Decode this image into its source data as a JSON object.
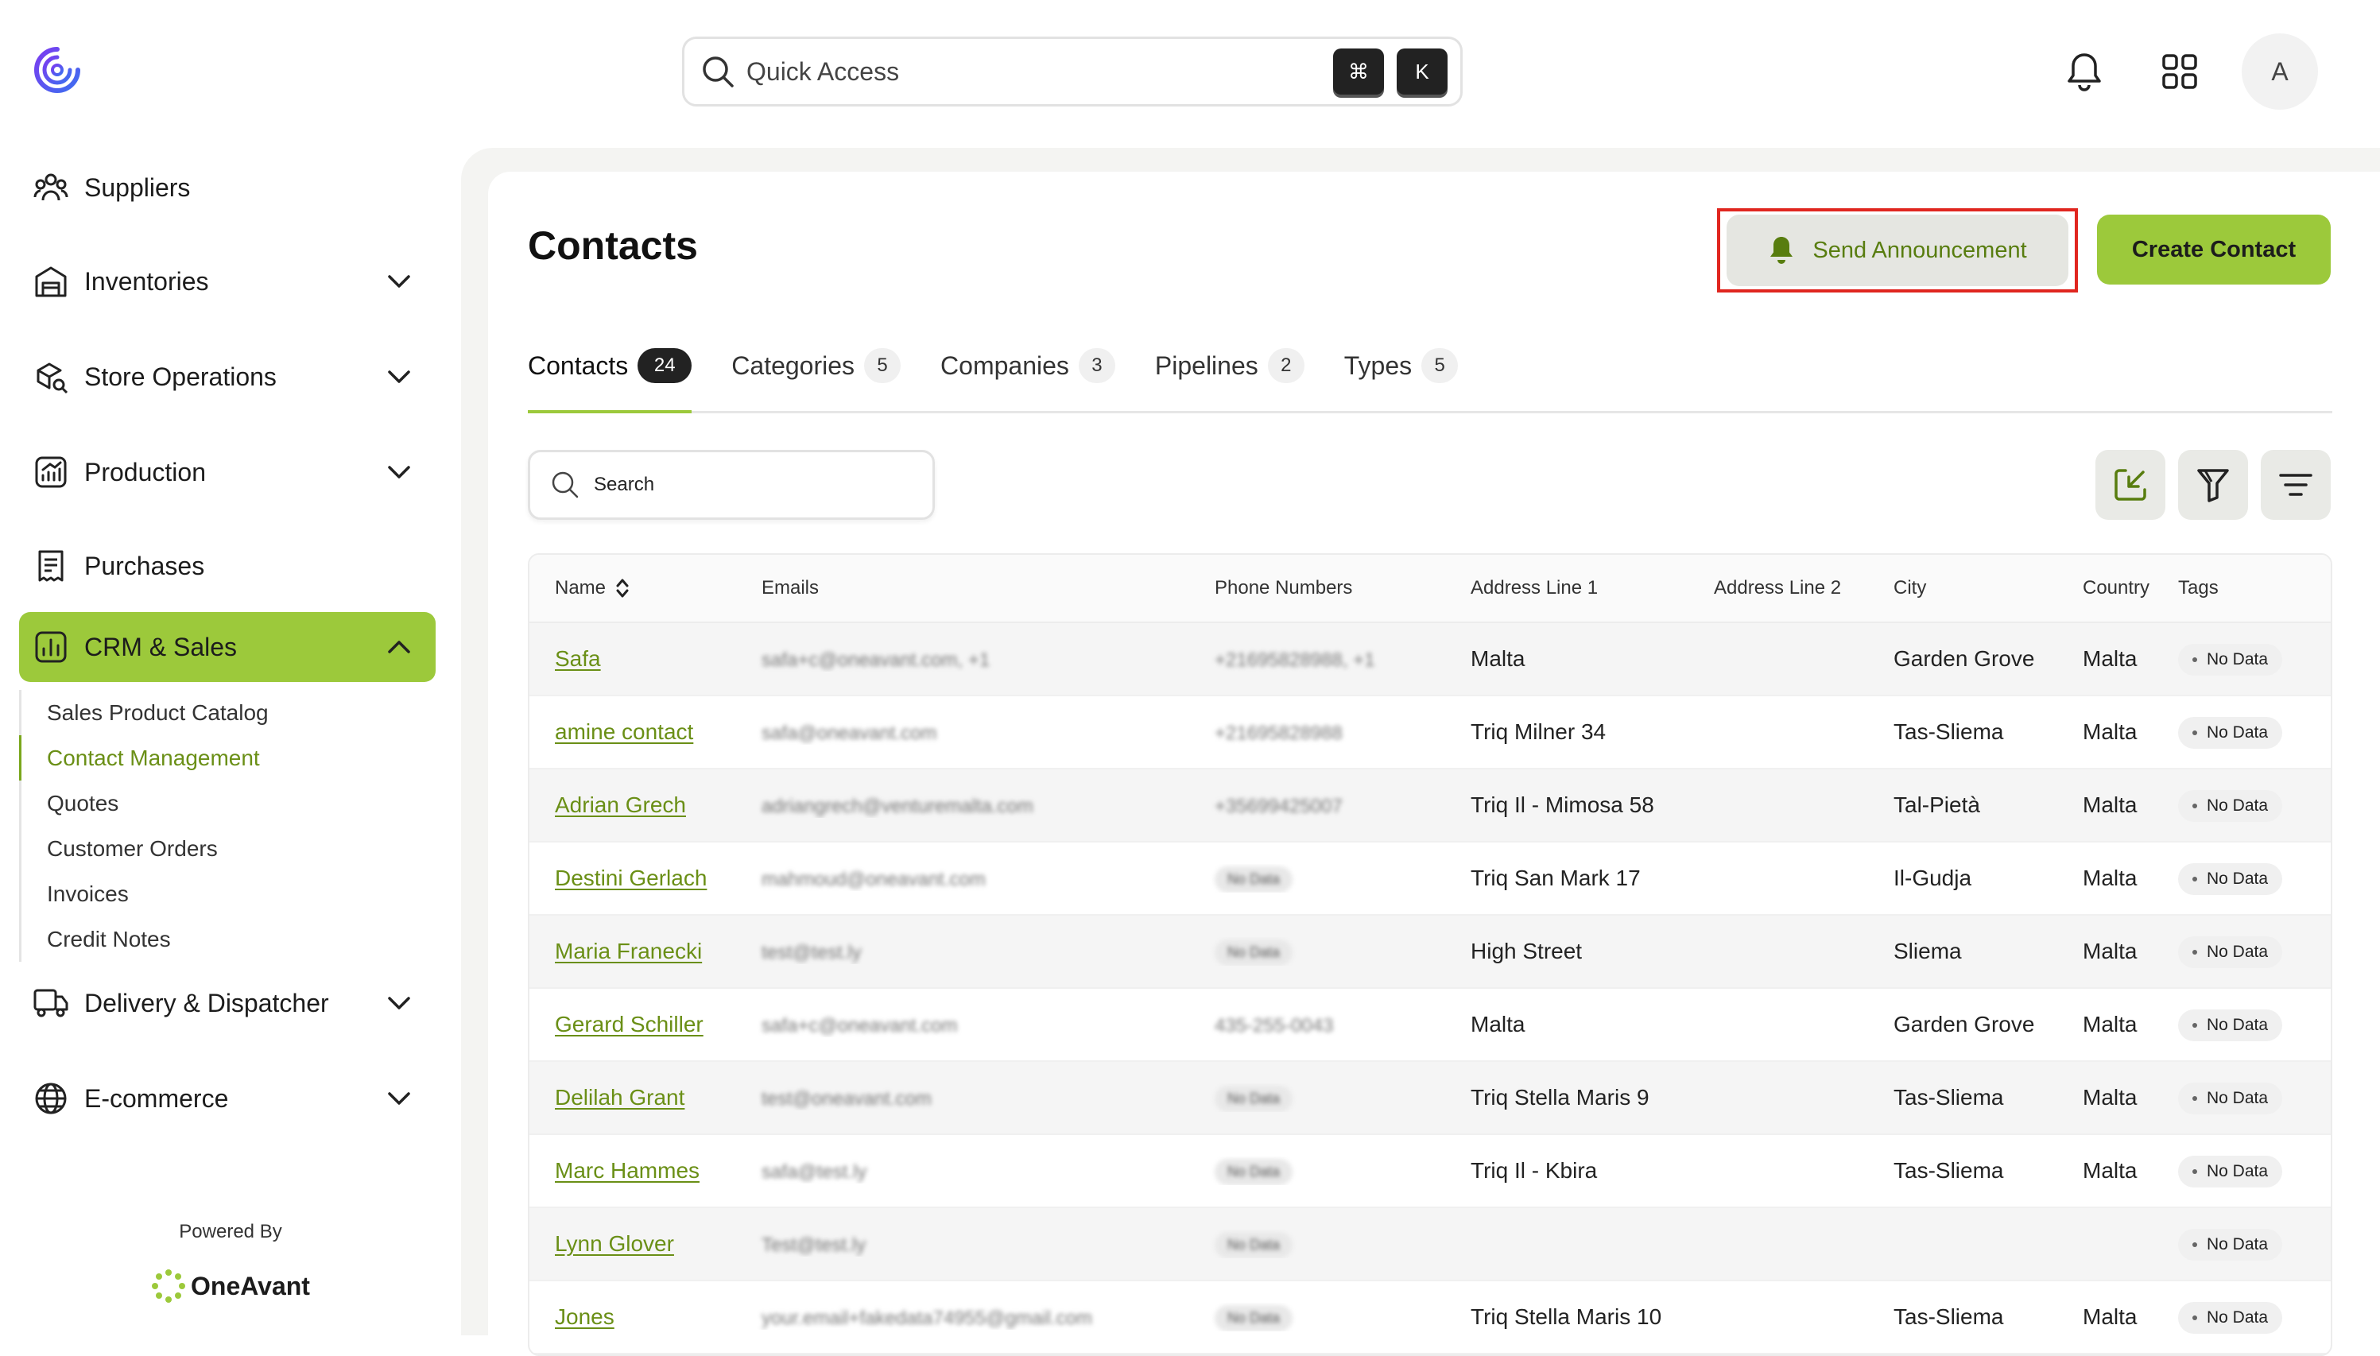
{
  "sidebar": {
    "items": [
      {
        "label": "Suppliers",
        "icon": "suppliers-icon",
        "expandable": false
      },
      {
        "label": "Inventories",
        "icon": "warehouse-icon",
        "expandable": true
      },
      {
        "label": "Store Operations",
        "icon": "store-ops-icon",
        "expandable": true
      },
      {
        "label": "Production",
        "icon": "production-chart-icon",
        "expandable": true
      },
      {
        "label": "Purchases",
        "icon": "receipt-icon",
        "expandable": false
      },
      {
        "label": "CRM & Sales",
        "icon": "crm-chart-icon",
        "expandable": true,
        "active": true
      },
      {
        "label": "Delivery & Dispatcher",
        "icon": "truck-icon",
        "expandable": true
      },
      {
        "label": "E-commerce",
        "icon": "globe-icon",
        "expandable": true
      }
    ],
    "crm_subitems": [
      "Sales Product Catalog",
      "Contact Management",
      "Quotes",
      "Customer Orders",
      "Invoices",
      "Credit Notes"
    ],
    "active_subitem": "Contact Management",
    "powered_by": "Powered By",
    "brand": "OneAvant"
  },
  "topbar": {
    "search_placeholder": "Quick Access",
    "shortcut_keys": [
      "⌘",
      "K"
    ],
    "avatar_initial": "A"
  },
  "page": {
    "title": "Contacts",
    "send_announcement_label": "Send Announcement",
    "create_contact_label": "Create Contact",
    "tabs": [
      {
        "label": "Contacts",
        "count": "24",
        "active": true
      },
      {
        "label": "Categories",
        "count": "5"
      },
      {
        "label": "Companies",
        "count": "3"
      },
      {
        "label": "Pipelines",
        "count": "2"
      },
      {
        "label": "Types",
        "count": "5"
      }
    ],
    "search_placeholder": "Search"
  },
  "table": {
    "columns": [
      "Name",
      "Emails",
      "Phone Numbers",
      "Address Line 1",
      "Address Line 2",
      "City",
      "Country",
      "Tags"
    ],
    "rows": [
      {
        "name": "Safa",
        "email": "safa+c@oneavant.com, +1",
        "phone": "+21695828988, +1",
        "phone_blank": false,
        "address1": "Malta",
        "address2": "",
        "city": "Garden Grove",
        "country": "Malta",
        "tag": "No Data"
      },
      {
        "name": "amine contact",
        "email": "safa@oneavant.com",
        "phone": "+21695828988",
        "phone_blank": false,
        "address1": "Triq Milner 34",
        "address2": "",
        "city": "Tas-Sliema",
        "country": "Malta",
        "tag": "No Data"
      },
      {
        "name": "Adrian Grech",
        "email": "adriangrech@venturemalta.com",
        "phone": "+35699425007",
        "phone_blank": false,
        "address1": "Triq Il - Mimosa 58",
        "address2": "",
        "city": "Tal-Pietà",
        "country": "Malta",
        "tag": "No Data"
      },
      {
        "name": "Destini Gerlach",
        "email": "mahmoud@oneavant.com",
        "phone": "No Data",
        "phone_blank": true,
        "address1": "Triq San Mark 17",
        "address2": "",
        "city": "Il-Gudja",
        "country": "Malta",
        "tag": "No Data"
      },
      {
        "name": "Maria Franecki",
        "email": "test@test.ly",
        "phone": "No Data",
        "phone_blank": true,
        "address1": "High Street",
        "address2": "",
        "city": "Sliema",
        "country": "Malta",
        "tag": "No Data"
      },
      {
        "name": "Gerard Schiller",
        "email": "safa+c@oneavant.com",
        "phone": "435-255-0043",
        "phone_blank": false,
        "address1": "Malta",
        "address2": "",
        "city": "Garden Grove",
        "country": "Malta",
        "tag": "No Data"
      },
      {
        "name": "Delilah Grant",
        "email": "test@oneavant.com",
        "phone": "No Data",
        "phone_blank": true,
        "address1": "Triq Stella Maris 9",
        "address2": "",
        "city": "Tas-Sliema",
        "country": "Malta",
        "tag": "No Data"
      },
      {
        "name": "Marc Hammes",
        "email": "safa@test.ly",
        "phone": "No Data",
        "phone_blank": true,
        "address1": "Triq Il - Kbira",
        "address2": "",
        "city": "Tas-Sliema",
        "country": "Malta",
        "tag": "No Data"
      },
      {
        "name": "Lynn Glover",
        "email": "Test@test.ly",
        "phone": "No Data",
        "phone_blank": true,
        "address1": "",
        "address2": "",
        "city": "",
        "country": "",
        "tag": "No Data"
      },
      {
        "name": "Jones",
        "email": "your.email+fakedata74955@gmail.com",
        "phone": "No Data",
        "phone_blank": true,
        "address1": "Triq Stella Maris 10",
        "address2": "",
        "city": "Tas-Sliema",
        "country": "Malta",
        "tag": "No Data"
      }
    ]
  },
  "colors": {
    "accent": "#9cc93b",
    "link": "#6a8f16",
    "highlight_box": "#e0261f"
  }
}
